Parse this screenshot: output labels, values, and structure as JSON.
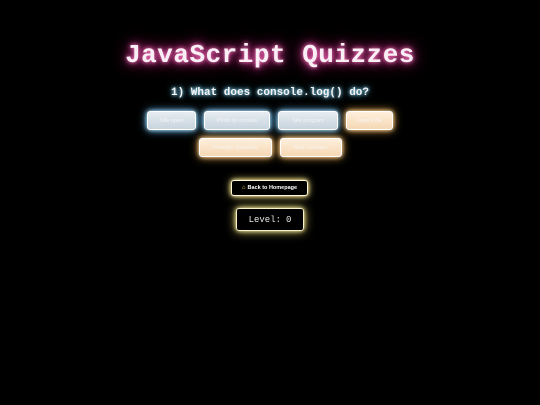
{
  "title": "JavaScript Quizzes",
  "question": "1) What does console.log() do?",
  "answers": [
    {
      "label": "Site open",
      "tone": "cool"
    },
    {
      "label": "Prints to console",
      "tone": "cool"
    },
    {
      "label": "Site program",
      "tone": "cool"
    },
    {
      "label": "Opens file",
      "tone": "warm"
    },
    {
      "label": "Prompts Question",
      "tone": "warm"
    },
    {
      "label": "New Function",
      "tone": "warm"
    }
  ],
  "back_button": {
    "icon": "home-icon",
    "label": "Back to Homepage"
  },
  "level": {
    "label": "Level:",
    "value": "0"
  },
  "colors": {
    "background": "#000000",
    "title_glow": "#ff4fb3",
    "question_glow": "#58c8ff",
    "answer_cool_glow": "#5fbfff",
    "answer_warm_glow": "#ffb347",
    "level_glow": "#d8c860"
  }
}
